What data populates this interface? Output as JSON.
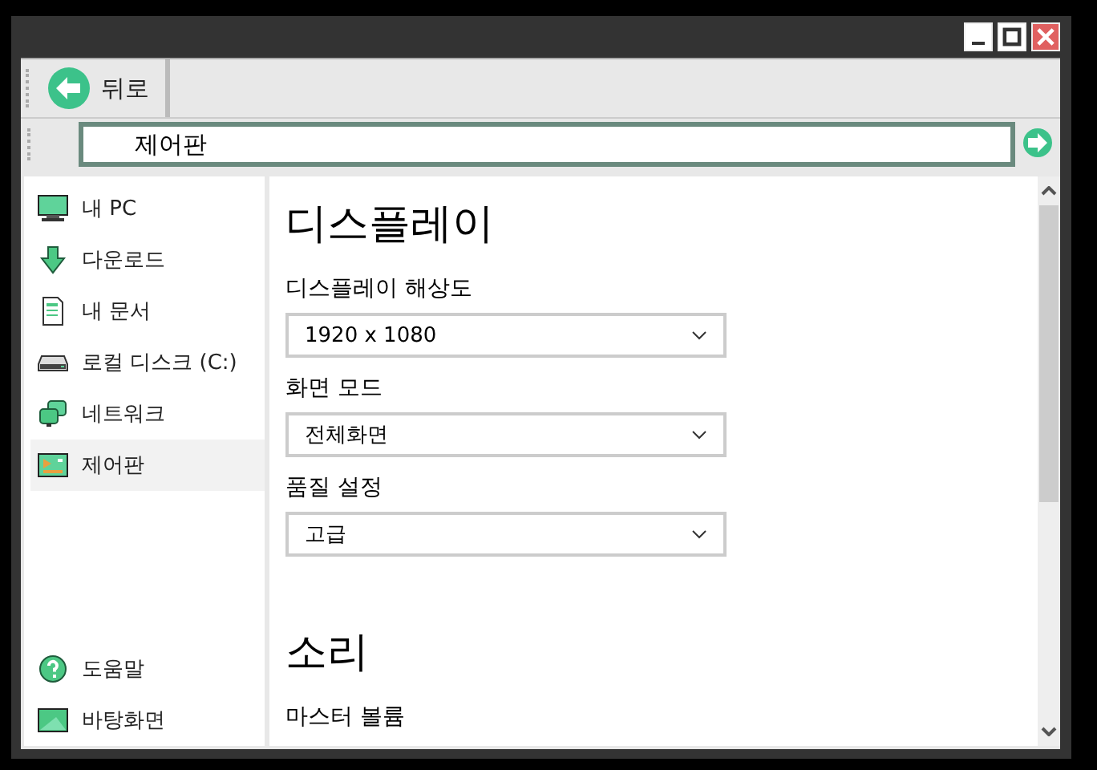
{
  "toolbar": {
    "back_label": "뒤로"
  },
  "address": {
    "value": "제어판"
  },
  "sidebar": {
    "items": [
      {
        "label": "내 PC",
        "kind": "pc",
        "selected": false
      },
      {
        "label": "다운로드",
        "kind": "download",
        "selected": false
      },
      {
        "label": "내 문서",
        "kind": "document",
        "selected": false
      },
      {
        "label": "로컬 디스크 (C:)",
        "kind": "disk",
        "selected": false
      },
      {
        "label": "네트워크",
        "kind": "network",
        "selected": false
      },
      {
        "label": "제어판",
        "kind": "control",
        "selected": true
      }
    ],
    "bottom_items": [
      {
        "label": "도움말",
        "kind": "help",
        "selected": false
      },
      {
        "label": "바탕화면",
        "kind": "desktop",
        "selected": false
      }
    ]
  },
  "sections": [
    {
      "title": "디스플레이",
      "settings": [
        {
          "label": "디스플레이 해상도",
          "value": "1920 x 1080"
        },
        {
          "label": "화면 모드",
          "value": "전체화면"
        },
        {
          "label": "품질 설정",
          "value": "고급"
        }
      ]
    },
    {
      "title": "소리",
      "settings": [
        {
          "label": "마스터 볼륨"
        }
      ]
    }
  ]
}
